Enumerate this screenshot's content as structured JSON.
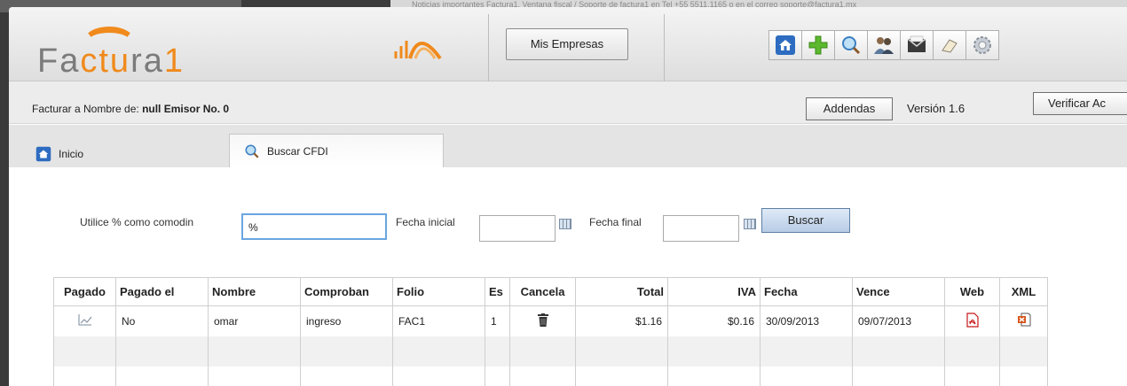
{
  "notice": "Noticias importantes Factura1. Ventana fiscal / Soporte de factura1 en Tel +55 5511.1165 o en el correo soporte@factura1.mx",
  "header": {
    "logo_text_left": "Fa",
    "logo_text_mid": "ctu",
    "logo_text_right": "ra",
    "logo_text_digit": "1",
    "mis_empresas_label": "Mis Empresas",
    "toolbar_icons": [
      "home-icon",
      "add-icon",
      "search-icon",
      "users-icon",
      "envelope-icon",
      "eraser-icon",
      "gear-icon"
    ]
  },
  "infobar": {
    "facturar_label": "Facturar a Nombre de: ",
    "facturar_value": "null Emisor No. 0",
    "addendas_label": "Addendas",
    "version_label": "Versión 1.6",
    "verificar_label": "Verificar Ac"
  },
  "tabs": [
    {
      "label": "Inicio",
      "icon": "home-icon"
    },
    {
      "label": "Buscar CFDI",
      "icon": "search-icon"
    }
  ],
  "search": {
    "comodin_label": "Utilice % como comodin",
    "comodin_value": "%",
    "fecha_inicial_label": "Fecha inicial",
    "fecha_inicial_value": "",
    "fecha_final_label": "Fecha final",
    "fecha_final_value": "",
    "buscar_label": "Buscar"
  },
  "table": {
    "headers": [
      "Pagado",
      "Pagado el",
      "Nombre",
      "Comproban",
      "Folio",
      "Es",
      "Cancela",
      "Total",
      "IVA",
      "Fecha",
      "Vence",
      "Web",
      "XML"
    ],
    "rows": [
      {
        "pagado_icon": "chart-icon",
        "pagado_el": "No",
        "nombre": "omar",
        "comprobante": "ingreso",
        "folio": "FAC1",
        "es": "1",
        "cancela_icon": "trash-icon",
        "total": "$1.16",
        "iva": "$0.16",
        "fecha": "30/09/2013",
        "vence": "09/07/2013",
        "web_icon": "pdf-icon",
        "xml_icon": "xml-icon"
      }
    ]
  },
  "colors": {
    "accent_orange": "#f08a1c",
    "button_blue": "#b7cce5",
    "focus_blue": "#6aa6e0"
  }
}
